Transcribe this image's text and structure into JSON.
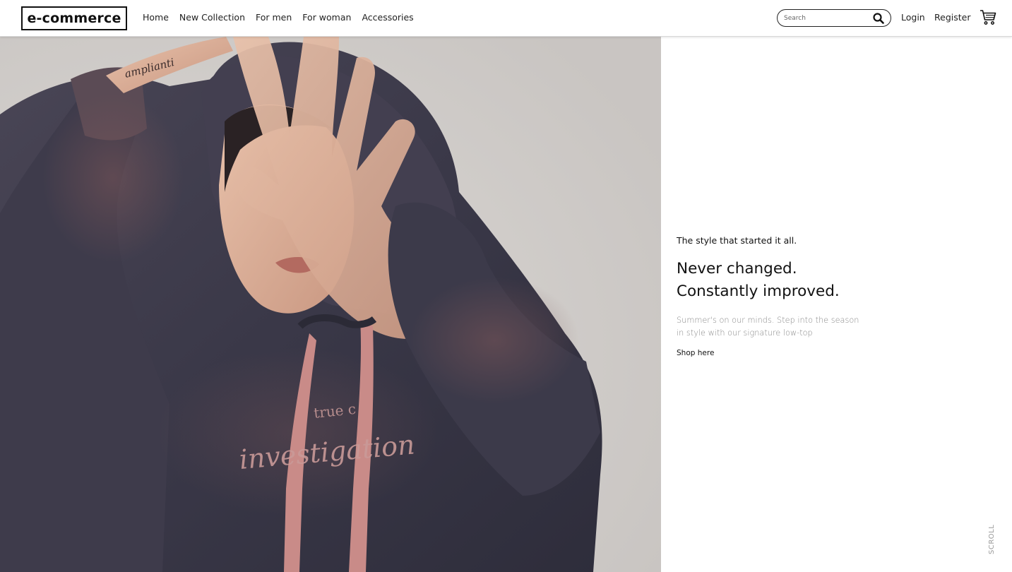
{
  "brand": {
    "logo_text": "e-commerce"
  },
  "nav": {
    "items": [
      {
        "label": "Home"
      },
      {
        "label": "New Collection"
      },
      {
        "label": "For men"
      },
      {
        "label": "For woman"
      },
      {
        "label": "Accessories"
      }
    ]
  },
  "search": {
    "placeholder": "Search",
    "value": ""
  },
  "auth": {
    "login_label": "Login",
    "register_label": "Register"
  },
  "hero": {
    "image_icon": "hooded-model-photo",
    "hoodie_print_top": "true c",
    "hoodie_print_script": "investigation",
    "tattoo_text": "amplianti"
  },
  "content": {
    "kicker": "The style that started it all.",
    "headline_line1": "Never changed.",
    "headline_line2": "Constantly improved.",
    "description": "Summer's on our minds. Step into the season in style with our signature low-top",
    "cta_label": "Shop here"
  },
  "scroll_label": "SCROLL",
  "icons": {
    "search": "search-icon",
    "cart": "cart-icon"
  },
  "colors": {
    "text": "#111111",
    "muted": "#8a8a8a",
    "hoodie": "#3b3a4a",
    "drawstring": "#c98b88"
  }
}
